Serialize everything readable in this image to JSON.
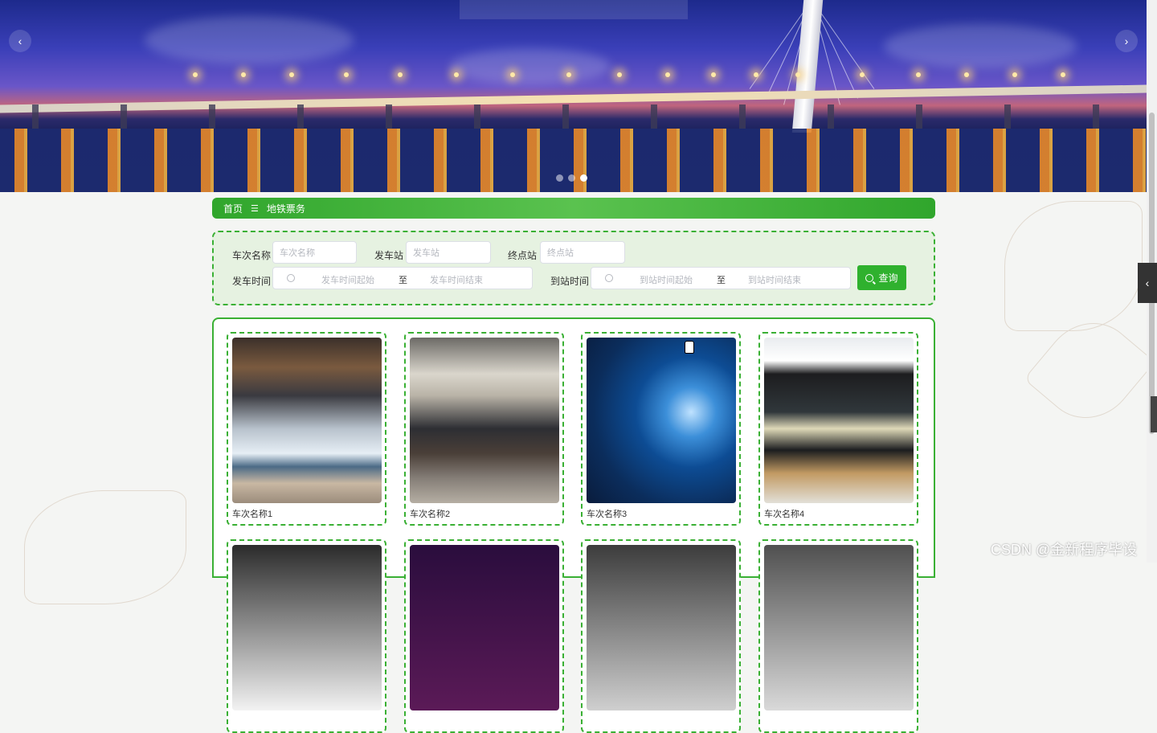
{
  "banner": {
    "prev_icon": "‹",
    "next_icon": "›",
    "slide_count": 3,
    "active_slide": 3
  },
  "breadcrumb": {
    "home": "首页",
    "separator_icon": "menu-icon",
    "separator": "☰",
    "current": "地铁票务"
  },
  "search": {
    "train_name_label": "车次名称",
    "train_name_placeholder": "车次名称",
    "departure_station_label": "发车站",
    "departure_station_placeholder": "发车站",
    "terminal_station_label": "终点站",
    "terminal_station_placeholder": "终点站",
    "departure_time_label": "发车时间",
    "departure_time_start": "发车时间起始",
    "departure_time_to": "至",
    "departure_time_end": "发车时间结束",
    "arrival_time_label": "到站时间",
    "arrival_time_start": "到站时间起始",
    "arrival_time_to": "至",
    "arrival_time_end": "到站时间结束",
    "query_button": "查询"
  },
  "cards": [
    {
      "name": "车次名称1"
    },
    {
      "name": "车次名称2"
    },
    {
      "name": "车次名称3"
    },
    {
      "name": "车次名称4"
    }
  ],
  "side_tab_icon": "‹",
  "watermark": "CSDN @金新程序毕设",
  "colors": {
    "accent": "#2fb12e",
    "panel_bg": "#e6f2e1"
  }
}
